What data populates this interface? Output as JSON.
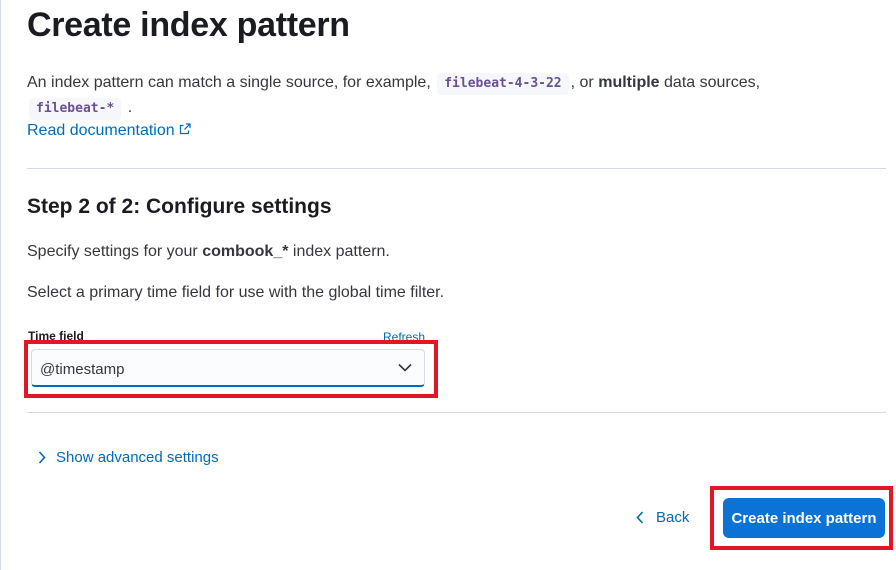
{
  "header": {
    "title": "Create index pattern",
    "description_part1": "An index pattern can match a single source, for example,",
    "example_single": "filebeat-4-3-22",
    "description_part2": ", or",
    "description_bold": "multiple",
    "description_part3": "data sources,",
    "example_multiple": "filebeat-*",
    "description_end": ".",
    "doc_link": "Read documentation"
  },
  "step": {
    "title": "Step 2 of 2: Configure settings",
    "settings_prefix": "Specify settings for your",
    "pattern_name": "combook_*",
    "settings_suffix": "index pattern.",
    "time_field_instructions": "Select a primary time field for use with the global time filter."
  },
  "time_field": {
    "label": "Time field",
    "refresh": "Refresh",
    "selected": "@timestamp"
  },
  "advanced": {
    "label": "Show advanced settings"
  },
  "footer": {
    "back_label": "Back",
    "create_label": "Create index pattern"
  },
  "colors": {
    "link": "#006bb8",
    "primary_button": "#0b72d6",
    "highlight_box": "#e01825"
  }
}
